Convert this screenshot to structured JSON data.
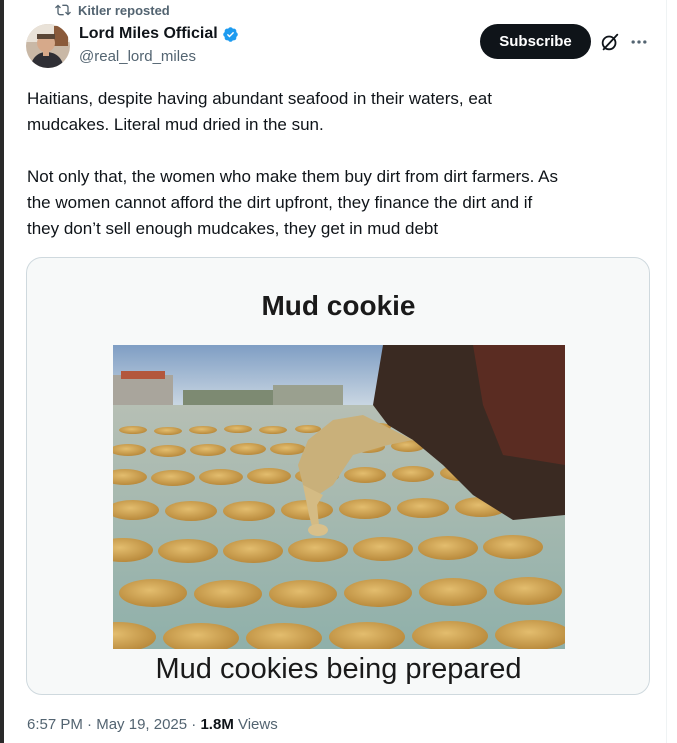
{
  "repost": {
    "label": "Kitler reposted"
  },
  "author": {
    "name": "Lord Miles Official",
    "handle": "@real_lord_miles",
    "verified": true
  },
  "actions": {
    "subscribe_label": "Subscribe",
    "grok_icon": "grok-icon",
    "more_icon": "more-options-icon"
  },
  "tweet": {
    "paragraph_1_line_1": "Haitians, despite having abundant seafood in their waters,  eat",
    "paragraph_1_line_2": "mudcakes. Literal mud dried in the sun.",
    "paragraph_2_line_1": "Not only that, the women who make them buy dirt from dirt farmers. As",
    "paragraph_2_line_2": "the women cannot afford the dirt upfront, they finance the dirt and if",
    "paragraph_2_line_3": "they don’t sell enough mudcakes, they get in mud debt"
  },
  "media": {
    "title": "Mud cookie",
    "caption": "Mud cookies being prepared"
  },
  "meta": {
    "time": "6:57 PM",
    "sep1": " · ",
    "date": "May 19, 2025",
    "sep2": " · ",
    "views_count": "1.8M",
    "views_label": " Views"
  },
  "colors": {
    "accent_verified": "#1d9bf0",
    "subscribe_bg": "#0f1419",
    "secondary_text": "#536471"
  }
}
